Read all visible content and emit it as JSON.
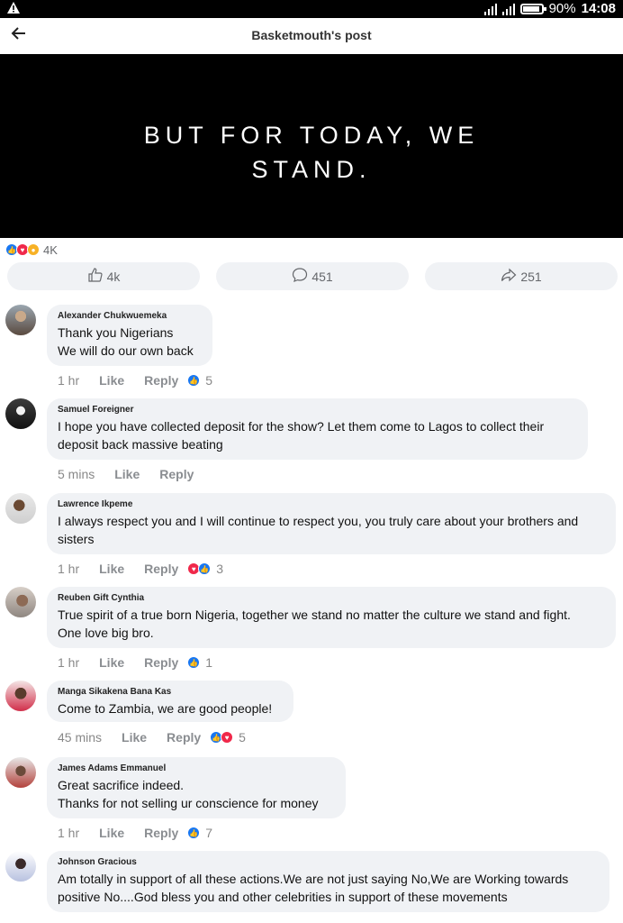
{
  "status_bar": {
    "battery": "90%",
    "time": "14:08",
    "battery_level": 0.9
  },
  "header": {
    "title": "Basketmouth's post"
  },
  "banner": {
    "line1": "BUT FOR TODAY, WE",
    "line2": "STAND."
  },
  "reactions": {
    "count": "4K"
  },
  "actions": {
    "like": "4k",
    "comment": "451",
    "share": "251"
  },
  "labels": {
    "like": "Like",
    "reply": "Reply"
  },
  "comments": [
    {
      "name": "Alexander Chukwuemeka",
      "lines": [
        "Thank you Nigerians",
        "We will do our own back"
      ],
      "time": "1 hr",
      "reactions": [
        "like"
      ],
      "count": "5"
    },
    {
      "name": "Samuel Foreigner",
      "lines": [
        "I hope you have collected deposit for the show? Let them come to Lagos to collect their",
        "deposit back massive beating"
      ],
      "time": "5 mins",
      "reactions": [],
      "count": ""
    },
    {
      "name": "Lawrence Ikpeme",
      "lines": [
        "I always respect you and I will continue to respect you, you truly care about your brothers and",
        "sisters"
      ],
      "time": "1 hr",
      "reactions": [
        "love",
        "like"
      ],
      "count": "3"
    },
    {
      "name": "Reuben Gift Cynthia",
      "lines": [
        "True spirit of a true born Nigeria, together we stand no matter the culture we stand and fight.",
        "One love big bro."
      ],
      "time": "1 hr",
      "reactions": [
        "like"
      ],
      "count": "1"
    },
    {
      "name": "Manga Sikakena Bana Kas",
      "lines": [
        "Come to Zambia, we are good people!"
      ],
      "time": "45 mins",
      "reactions": [
        "like",
        "love"
      ],
      "count": "5"
    },
    {
      "name": "James Adams Emmanuel",
      "lines": [
        "Great sacrifice indeed.",
        "Thanks for not selling ur conscience for money"
      ],
      "time": "1 hr",
      "reactions": [
        "like"
      ],
      "count": "7"
    },
    {
      "name": "Johnson Gracious",
      "lines": [
        "Am totally in support of all these actions.We are not just saying No,We are Working towards",
        "positive No....God bless you and other celebrities in support of these movements"
      ],
      "time": "",
      "reactions": [],
      "count": ""
    }
  ]
}
